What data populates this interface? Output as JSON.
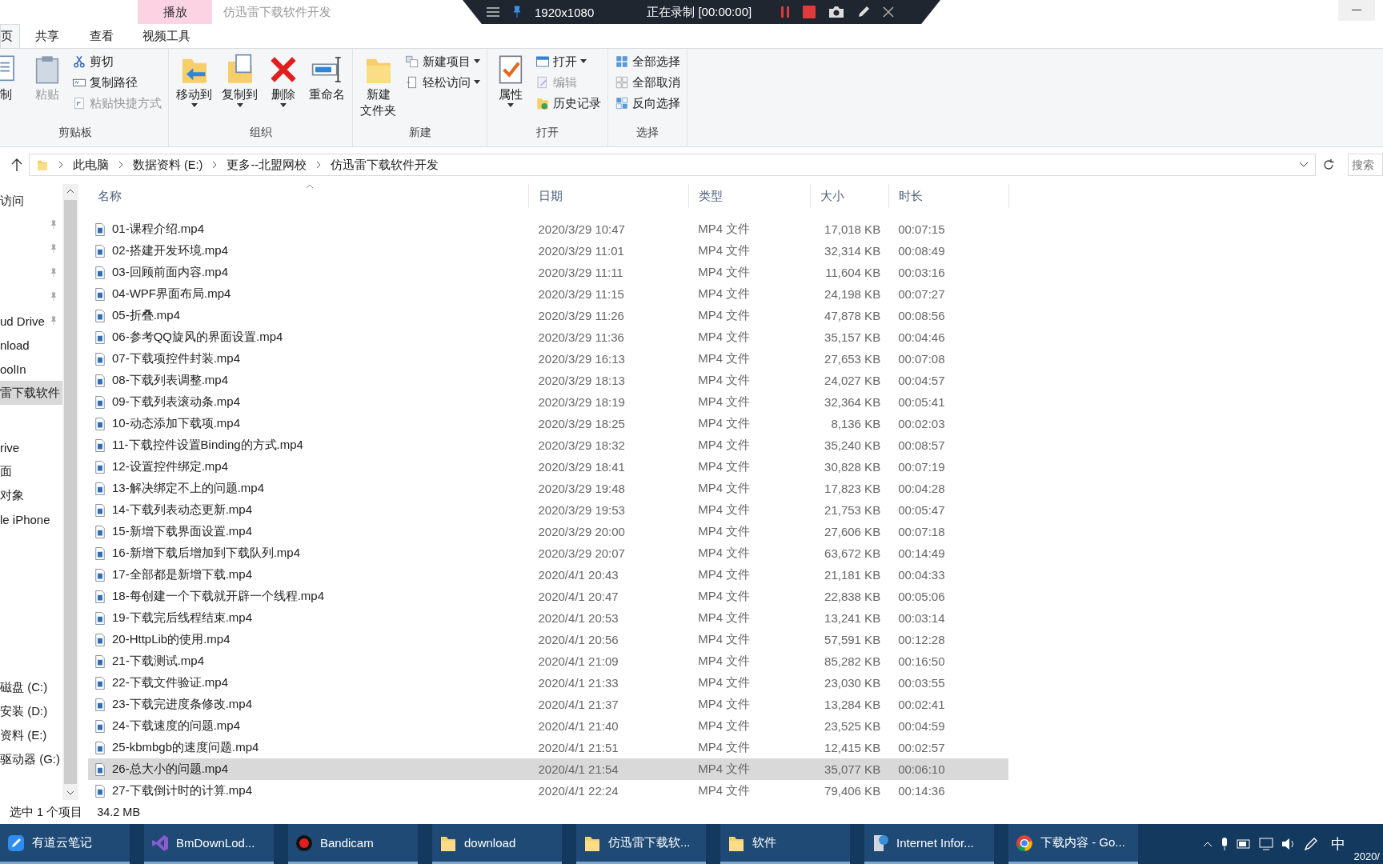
{
  "recorder": {
    "resolution": "1920x1080",
    "status": "正在录制 [00:00:00]"
  },
  "window": {
    "title": "仿迅雷下载软件开发",
    "context_tab": "播放"
  },
  "tabs": [
    {
      "label": "页",
      "selected": true
    },
    {
      "label": "共享",
      "selected": false
    },
    {
      "label": "查看",
      "selected": false
    },
    {
      "label": "视频工具",
      "selected": false
    }
  ],
  "ribbon": [
    {
      "label": "剪贴板",
      "large": [
        {
          "lines": [
            "制"
          ],
          "menu": false,
          "disabled": false
        },
        {
          "lines": [
            "粘贴"
          ],
          "menu": false,
          "disabled": true
        }
      ],
      "small": [
        {
          "label": "剪切",
          "menu": false,
          "disabled": false
        },
        {
          "label": "复制路径",
          "menu": false,
          "disabled": false
        },
        {
          "label": "粘贴快捷方式",
          "menu": false,
          "disabled": true
        }
      ]
    },
    {
      "label": "组织",
      "large": [
        {
          "lines": [
            "移动到"
          ],
          "menu": true,
          "disabled": false
        },
        {
          "lines": [
            "复制到"
          ],
          "menu": true,
          "disabled": false
        },
        {
          "lines": [
            "删除"
          ],
          "menu": true,
          "disabled": false
        },
        {
          "lines": [
            "重命名"
          ],
          "menu": false,
          "disabled": false
        }
      ]
    },
    {
      "label": "新建",
      "large": [
        {
          "lines": [
            "新建",
            "文件夹"
          ],
          "menu": false,
          "disabled": false
        }
      ],
      "small": [
        {
          "label": "新建项目",
          "menu": true,
          "disabled": false
        },
        {
          "label": "轻松访问",
          "menu": true,
          "disabled": false
        }
      ]
    },
    {
      "label": "打开",
      "large": [
        {
          "lines": [
            "属性"
          ],
          "menu": true,
          "disabled": false
        }
      ],
      "small": [
        {
          "label": "打开",
          "menu": true,
          "disabled": false
        },
        {
          "label": "编辑",
          "menu": false,
          "disabled": true
        },
        {
          "label": "历史记录",
          "menu": false,
          "disabled": false
        }
      ]
    },
    {
      "label": "选择",
      "small": [
        {
          "label": "全部选择",
          "menu": false,
          "disabled": false
        },
        {
          "label": "全部取消",
          "menu": false,
          "disabled": false
        },
        {
          "label": "反向选择",
          "menu": false,
          "disabled": false
        }
      ]
    }
  ],
  "address": {
    "crumbs": [
      "此电脑",
      "数据资料 (E:)",
      "更多--北盟网校",
      "仿迅雷下载软件开发"
    ],
    "search_placeholder": "搜索"
  },
  "nav": [
    {
      "items": [
        {
          "label": "访问",
          "pinned": false,
          "selected": false
        },
        {
          "pinned": true,
          "selected": false
        },
        {
          "pinned": true,
          "selected": false
        },
        {
          "pinned": true,
          "selected": false
        },
        {
          "pinned": true,
          "selected": false
        },
        {
          "label": "ud Drive",
          "pinned": true,
          "selected": false
        },
        {
          "label": "nload",
          "pinned": false,
          "selected": false
        },
        {
          "label": "oolIn",
          "pinned": false,
          "selected": false
        },
        {
          "label": "雷下载软件",
          "pinned": false,
          "selected": true
        }
      ]
    },
    {
      "items": [
        {
          "label": "rive",
          "pinned": false,
          "selected": false
        },
        {
          "label": "面",
          "pinned": false,
          "selected": false
        },
        {
          "label": "对象",
          "pinned": false,
          "selected": false
        },
        {
          "label": "le iPhone",
          "pinned": false,
          "selected": false
        }
      ]
    },
    {
      "items": [
        {
          "label": "磁盘 (C:)",
          "pinned": false,
          "selected": false
        },
        {
          "label": "安装 (D:)",
          "pinned": false,
          "selected": false
        },
        {
          "label": "资料 (E:)",
          "pinned": false,
          "selected": false
        },
        {
          "label": "驱动器 (G:)",
          "pinned": false,
          "selected": false
        }
      ]
    }
  ],
  "columns": [
    "名称",
    "日期",
    "类型",
    "大小",
    "时长"
  ],
  "rows": [
    {
      "name": "01-课程介绍.mp4",
      "date": "2020/3/29 10:47",
      "type": "MP4 文件",
      "size": "17,018 KB",
      "duration": "00:07:15",
      "selected": false
    },
    {
      "name": "02-搭建开发环境.mp4",
      "date": "2020/3/29 11:01",
      "type": "MP4 文件",
      "size": "32,314 KB",
      "duration": "00:08:49",
      "selected": false
    },
    {
      "name": "03-回顾前面内容.mp4",
      "date": "2020/3/29 11:11",
      "type": "MP4 文件",
      "size": "11,604 KB",
      "duration": "00:03:16",
      "selected": false
    },
    {
      "name": "04-WPF界面布局.mp4",
      "date": "2020/3/29 11:15",
      "type": "MP4 文件",
      "size": "24,198 KB",
      "duration": "00:07:27",
      "selected": false
    },
    {
      "name": "05-折叠.mp4",
      "date": "2020/3/29 11:26",
      "type": "MP4 文件",
      "size": "47,878 KB",
      "duration": "00:08:56",
      "selected": false
    },
    {
      "name": "06-参考QQ旋风的界面设置.mp4",
      "date": "2020/3/29 11:36",
      "type": "MP4 文件",
      "size": "35,157 KB",
      "duration": "00:04:46",
      "selected": false
    },
    {
      "name": "07-下载项控件封装.mp4",
      "date": "2020/3/29 16:13",
      "type": "MP4 文件",
      "size": "27,653 KB",
      "duration": "00:07:08",
      "selected": false
    },
    {
      "name": "08-下载列表调整.mp4",
      "date": "2020/3/29 18:13",
      "type": "MP4 文件",
      "size": "24,027 KB",
      "duration": "00:04:57",
      "selected": false
    },
    {
      "name": "09-下载列表滚动条.mp4",
      "date": "2020/3/29 18:19",
      "type": "MP4 文件",
      "size": "32,364 KB",
      "duration": "00:05:41",
      "selected": false
    },
    {
      "name": "10-动态添加下载项.mp4",
      "date": "2020/3/29 18:25",
      "type": "MP4 文件",
      "size": "8,136 KB",
      "duration": "00:02:03",
      "selected": false
    },
    {
      "name": "11-下载控件设置Binding的方式.mp4",
      "date": "2020/3/29 18:32",
      "type": "MP4 文件",
      "size": "35,240 KB",
      "duration": "00:08:57",
      "selected": false
    },
    {
      "name": "12-设置控件绑定.mp4",
      "date": "2020/3/29 18:41",
      "type": "MP4 文件",
      "size": "30,828 KB",
      "duration": "00:07:19",
      "selected": false
    },
    {
      "name": "13-解决绑定不上的问题.mp4",
      "date": "2020/3/29 19:48",
      "type": "MP4 文件",
      "size": "17,823 KB",
      "duration": "00:04:28",
      "selected": false
    },
    {
      "name": "14-下载列表动态更新.mp4",
      "date": "2020/3/29 19:53",
      "type": "MP4 文件",
      "size": "21,753 KB",
      "duration": "00:05:47",
      "selected": false
    },
    {
      "name": "15-新增下载界面设置.mp4",
      "date": "2020/3/29 20:00",
      "type": "MP4 文件",
      "size": "27,606 KB",
      "duration": "00:07:18",
      "selected": false
    },
    {
      "name": "16-新增下载后增加到下载队列.mp4",
      "date": "2020/3/29 20:07",
      "type": "MP4 文件",
      "size": "63,672 KB",
      "duration": "00:14:49",
      "selected": false
    },
    {
      "name": "17-全部都是新增下载.mp4",
      "date": "2020/4/1 20:43",
      "type": "MP4 文件",
      "size": "21,181 KB",
      "duration": "00:04:33",
      "selected": false
    },
    {
      "name": "18-每创建一个下载就开辟一个线程.mp4",
      "date": "2020/4/1 20:47",
      "type": "MP4 文件",
      "size": "22,838 KB",
      "duration": "00:05:06",
      "selected": false
    },
    {
      "name": "19-下载完后线程结束.mp4",
      "date": "2020/4/1 20:53",
      "type": "MP4 文件",
      "size": "13,241 KB",
      "duration": "00:03:14",
      "selected": false
    },
    {
      "name": "20-HttpLib的使用.mp4",
      "date": "2020/4/1 20:56",
      "type": "MP4 文件",
      "size": "57,591 KB",
      "duration": "00:12:28",
      "selected": false
    },
    {
      "name": "21-下载测试.mp4",
      "date": "2020/4/1 21:09",
      "type": "MP4 文件",
      "size": "85,282 KB",
      "duration": "00:16:50",
      "selected": false
    },
    {
      "name": "22-下载文件验证.mp4",
      "date": "2020/4/1 21:33",
      "type": "MP4 文件",
      "size": "23,030 KB",
      "duration": "00:03:55",
      "selected": false
    },
    {
      "name": "23-下载完进度条修改.mp4",
      "date": "2020/4/1 21:37",
      "type": "MP4 文件",
      "size": "13,284 KB",
      "duration": "00:02:41",
      "selected": false
    },
    {
      "name": "24-下载速度的问题.mp4",
      "date": "2020/4/1 21:40",
      "type": "MP4 文件",
      "size": "23,525 KB",
      "duration": "00:04:59",
      "selected": false
    },
    {
      "name": "25-kbmbgb的速度问题.mp4",
      "date": "2020/4/1 21:51",
      "type": "MP4 文件",
      "size": "12,415 KB",
      "duration": "00:02:57",
      "selected": false
    },
    {
      "name": "26-总大小的问题.mp4",
      "date": "2020/4/1 21:54",
      "type": "MP4 文件",
      "size": "35,077 KB",
      "duration": "00:06:10",
      "selected": true
    },
    {
      "name": "27-下载倒计时的计算.mp4",
      "date": "2020/4/1 22:24",
      "type": "MP4 文件",
      "size": "79,406 KB",
      "duration": "00:14:36",
      "selected": false
    }
  ],
  "status_bar": {
    "selection": "选中 1 个项目",
    "size": "34.2 MB"
  },
  "taskbar": {
    "apps": [
      "有道云笔记",
      "BmDownLod...",
      "Bandicam",
      "download",
      "仿迅雷下载软...",
      "软件",
      "Internet Infor...",
      "下载内容 - Go..."
    ],
    "ime": "中",
    "date": "2020/"
  }
}
